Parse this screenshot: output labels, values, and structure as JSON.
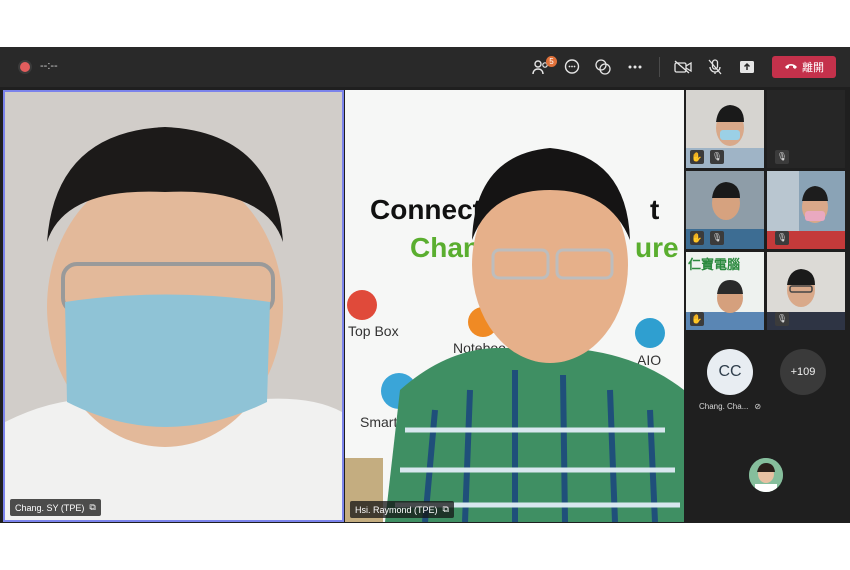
{
  "toolbar": {
    "record_time": "--:--",
    "participants_count": "5",
    "leave_label": "離開",
    "icons": [
      "participants-icon",
      "chat-icon",
      "reactions-icon",
      "more-icon",
      "camera-off-icon",
      "mic-off-icon",
      "share-icon",
      "hangup-icon"
    ]
  },
  "tiles": {
    "main1_name": "Chang. SY (TPE)",
    "main2_name": "Hsi. Raymond (TPE)"
  },
  "slide": {
    "line1": "Connect Y",
    "line1_tail": "t",
    "line2": "Chang",
    "line2_tail": "ure",
    "labels": [
      "Top Box",
      "Noteboo",
      "AIO",
      "Smart"
    ]
  },
  "sidebar": {
    "logo_text": "仁寶電腦",
    "cc_initials": "CC",
    "cc_name": "Chang. Cha...",
    "more_count": "+109"
  },
  "colors": {
    "accent": "#7b83eb",
    "leave": "#c4314b",
    "badge": "#e0713a"
  }
}
